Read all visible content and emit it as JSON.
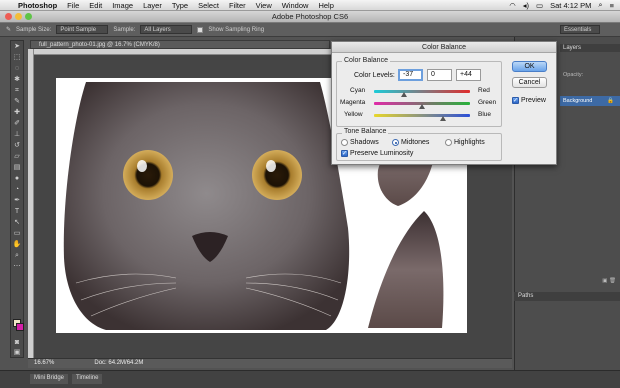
{
  "menubar": {
    "app": "Photoshop",
    "items": [
      "File",
      "Edit",
      "Image",
      "Layer",
      "Type",
      "Select",
      "Filter",
      "View",
      "Window",
      "Help"
    ],
    "clock": "Sat 4:12 PM"
  },
  "window": {
    "title": "Adobe Photoshop CS6"
  },
  "options": {
    "sample_size_label": "Sample Size:",
    "sample_size_value": "Point Sample",
    "sample_label": "Sample:",
    "sample_value": "All Layers",
    "show_ring_label": "Show Sampling Ring",
    "workspace": "Essentials"
  },
  "document": {
    "tab_title": "full_pattern_photo-01.jpg @ 16.7% (CMYK/8)",
    "zoom": "16.67%",
    "doc_info": "Doc: 64.2M/64.2M"
  },
  "bottom_tabs": [
    "Mini Bridge",
    "Timeline"
  ],
  "panels": {
    "layers_title": "Layers",
    "layer_opacity": "Opacity:",
    "layer_name": "Background",
    "paths_title": "Paths"
  },
  "dialog": {
    "title": "Color Balance",
    "group_title": "Color Balance",
    "levels_label": "Color Levels:",
    "levels": [
      "-37",
      "0",
      "+44"
    ],
    "sliders": [
      {
        "left": "Cyan",
        "right": "Red",
        "value": -37
      },
      {
        "left": "Magenta",
        "right": "Green",
        "value": 0
      },
      {
        "left": "Yellow",
        "right": "Blue",
        "value": 44
      }
    ],
    "tone_title": "Tone Balance",
    "tones": [
      "Shadows",
      "Midtones",
      "Highlights"
    ],
    "selected_tone": "Midtones",
    "preserve_label": "Preserve Luminosity",
    "ok_label": "OK",
    "cancel_label": "Cancel",
    "preview_label": "Preview"
  },
  "colors": {
    "foreground": "#f1e7c8",
    "background": "#d41fa8",
    "accent": "#3d6aa5"
  }
}
